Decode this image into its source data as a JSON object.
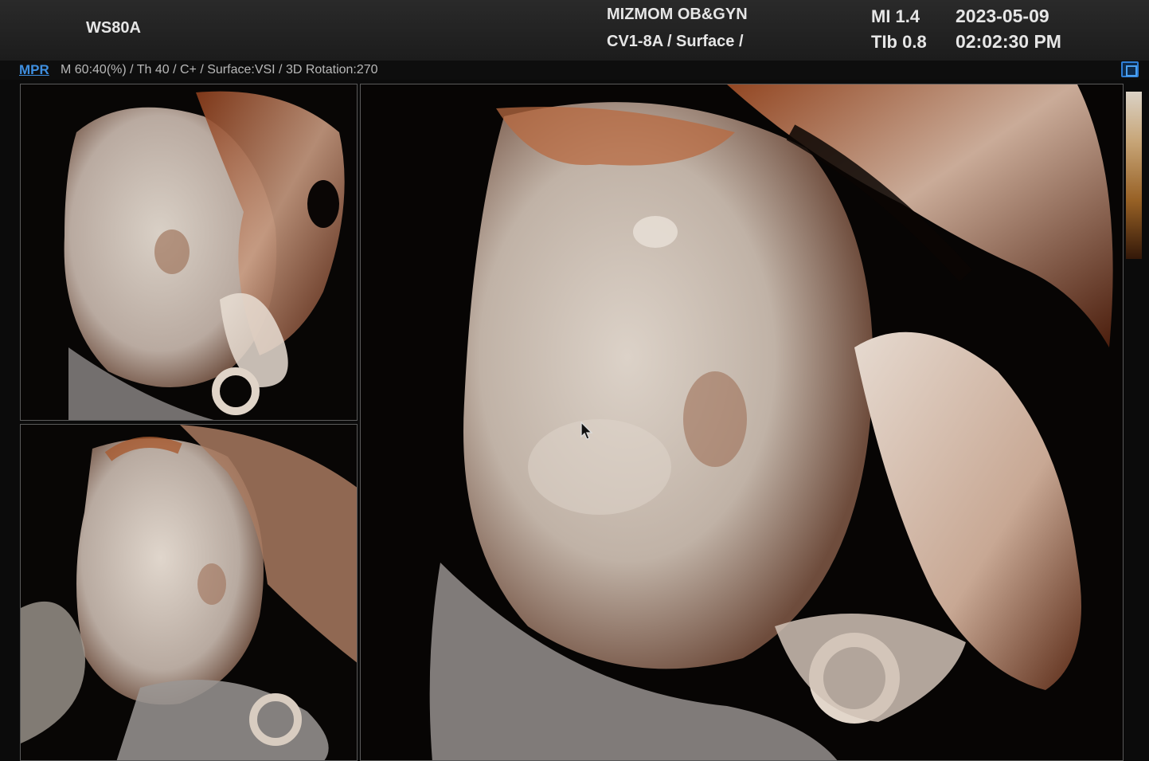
{
  "header": {
    "model": "WS80A",
    "clinic": "MIZMOM OB&GYN",
    "probe_mode": "CV1-8A / Surface /",
    "mi_text": "MI  1.4",
    "tib_text": "TIb 0.8",
    "date": "2023-05-09",
    "time": "02:02:30 PM"
  },
  "infobar": {
    "mode_label": "MPR",
    "parameters": "M 60:40(%) / Th 40 / C+ / Surface:VSI / 3D Rotation:270"
  },
  "icons": {
    "layout": "layout-toggle-icon",
    "cursor": "mouse-pointer-icon"
  },
  "colors": {
    "accent": "#3f8fe0",
    "header_text": "#e6e6e6",
    "background": "#0b0b0b",
    "tissue_light": "#d8ccc0",
    "tissue_dark": "#7a3a1e"
  }
}
